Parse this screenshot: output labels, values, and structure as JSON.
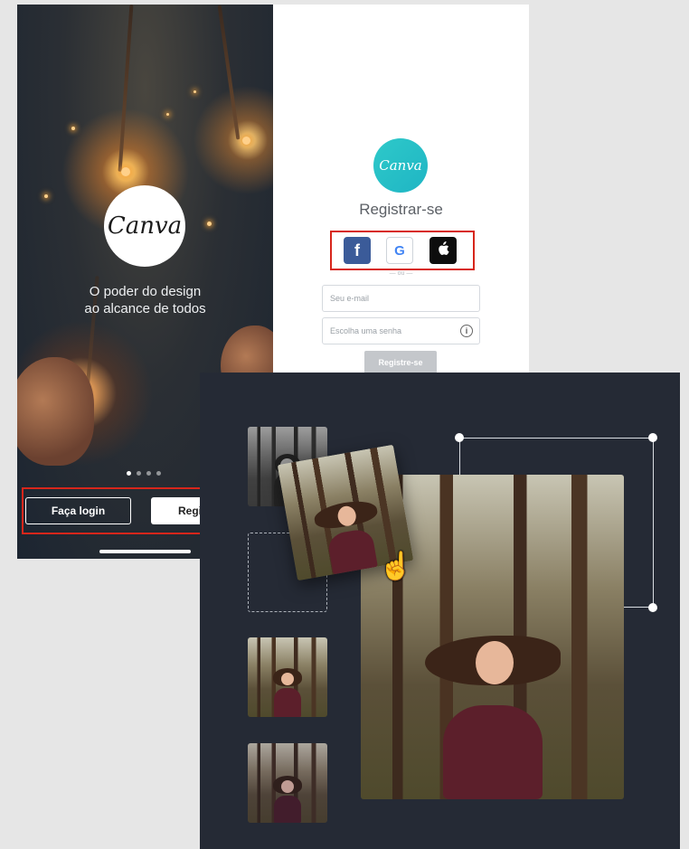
{
  "splash": {
    "logo_text": "Canva",
    "tagline_line1": "O poder do design",
    "tagline_line2": "ao alcance de todos",
    "page_indicator": {
      "count": 4,
      "active": 1
    },
    "login_button": "Faça login",
    "register_button_partial": "Regi"
  },
  "register": {
    "logo_text": "Canva",
    "title": "Registrar-se",
    "social_buttons": [
      {
        "name": "facebook",
        "glyph": "f"
      },
      {
        "name": "google",
        "glyph": "G"
      },
      {
        "name": "apple",
        "glyph": ""
      }
    ],
    "or_text": "ou",
    "email_placeholder": "Seu e-mail",
    "password_placeholder": "Escolha uma senha",
    "submit_button": "Registre-se"
  },
  "editor": {
    "thumbnails": [
      "forest-photo-bw",
      "forest-photo-warm",
      "forest-photo-cool"
    ],
    "dragging_photo": "forest-photo-warm",
    "canvas_photo": "forest-photo-warm"
  },
  "colors": {
    "highlight": "#d7261b",
    "canva_teal": "#20c4cb",
    "facebook": "#3b5b99",
    "editor_bg": "#252a35"
  }
}
